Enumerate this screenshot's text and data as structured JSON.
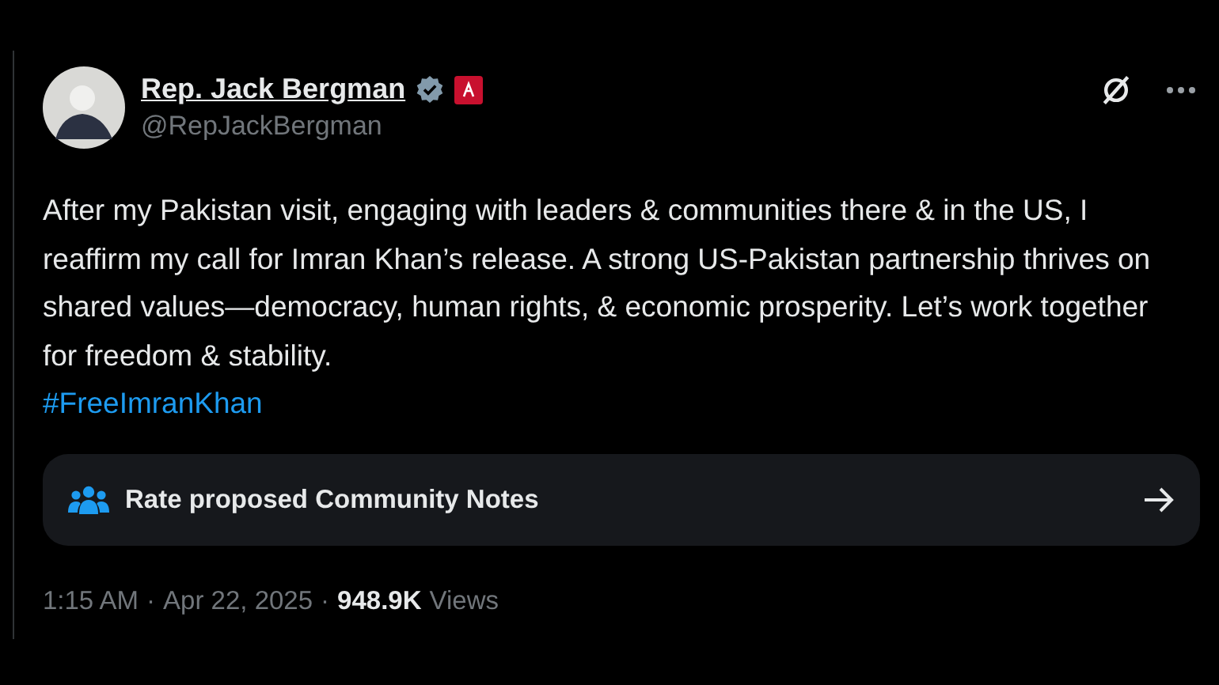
{
  "author": {
    "name": "Rep. Jack Bergman",
    "handle": "@RepJackBergman",
    "verified": true
  },
  "text": "After my Pakistan visit, engaging with leaders & communities there & in the US, I reaffirm my call for Imran Khan’s release. A strong US-Pakistan partnership thrives on shared values—democracy, human rights, & economic prosperity. Let’s work together for freedom & stability.",
  "hashtag": "#FreeImranKhan",
  "community_notes": {
    "label": "Rate proposed Community Notes"
  },
  "meta": {
    "time": "1:15 AM",
    "separator_1": "·",
    "date": "Apr 22, 2025",
    "separator_2": "·",
    "views_count": "948.9K",
    "views_label": "Views"
  }
}
